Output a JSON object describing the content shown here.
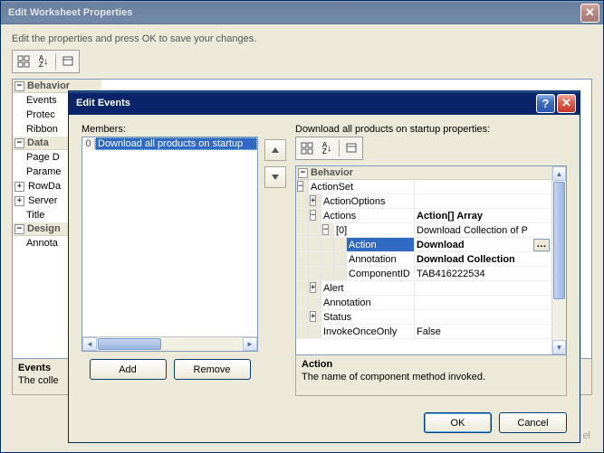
{
  "mainWindow": {
    "title": "Edit Worksheet Properties",
    "instruction": "Edit the properties and press OK to save your changes.",
    "tree": {
      "behavior": "Behavior",
      "items1": [
        "Events",
        "Protec",
        "Ribbon"
      ],
      "data": "Data",
      "items2": [
        "Page D",
        "Parame",
        "RowDa",
        "Server",
        "Title"
      ],
      "design": "Design",
      "items3": [
        "Annota"
      ]
    },
    "bottomLabel": "Events",
    "bottomText": "The colle"
  },
  "editEvents": {
    "title": "Edit Events",
    "membersLabel": "Members:",
    "memberIndex": "0",
    "memberText": "Download all products on startup",
    "propsLabel": "Download all products on startup properties:",
    "addBtn": "Add",
    "removeBtn": "Remove",
    "okBtn": "OK",
    "cancelBtn": "Cancel",
    "grid": {
      "behavior": "Behavior",
      "actionSet": "ActionSet",
      "actionOptions": "ActionOptions",
      "actions": "Actions",
      "actionsVal": "Action[] Array",
      "idx0": "[0]",
      "idx0Val": "Download Collection of P",
      "action": "Action",
      "actionVal": "Download",
      "annotation": "Annotation",
      "annotationVal": "Download Collection",
      "componentID": "ComponentID",
      "componentIDVal": "TAB416222534",
      "alert": "Alert",
      "annotation2": "Annotation",
      "status": "Status",
      "invokeOnce": "InvokeOnceOnly",
      "invokeOnceVal": "False"
    },
    "desc": {
      "title": "Action",
      "text": "The name of component method invoked."
    }
  }
}
